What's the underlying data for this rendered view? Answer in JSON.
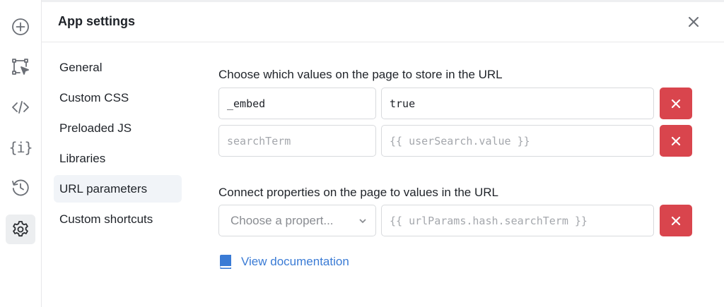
{
  "rail": {
    "items": [
      {
        "name": "add-icon"
      },
      {
        "name": "select-frame-icon"
      },
      {
        "name": "code-icon"
      },
      {
        "name": "variables-icon",
        "glyph": "{i}"
      },
      {
        "name": "history-icon"
      },
      {
        "name": "settings-icon",
        "active": true
      }
    ]
  },
  "header": {
    "title": "App settings"
  },
  "nav": {
    "items": [
      {
        "label": "General"
      },
      {
        "label": "Custom CSS"
      },
      {
        "label": "Preloaded JS"
      },
      {
        "label": "Libraries"
      },
      {
        "label": "URL parameters",
        "active": true
      },
      {
        "label": "Custom shortcuts"
      }
    ]
  },
  "url_params": {
    "store_label": "Choose which values on the page to store in the URL",
    "rows": [
      {
        "key": "_embed",
        "value": "true"
      },
      {
        "key_placeholder": "searchTerm",
        "value_placeholder": "{{ userSearch.value }}"
      }
    ],
    "connect_label": "Connect properties on the page to values in the URL",
    "connect_row": {
      "property_placeholder": "Choose a propert...",
      "value_placeholder": "{{ urlParams.hash.searchTerm }}"
    },
    "doc_link": "View documentation"
  },
  "colors": {
    "accent": "#3a7bd5",
    "danger": "#d9454d"
  }
}
